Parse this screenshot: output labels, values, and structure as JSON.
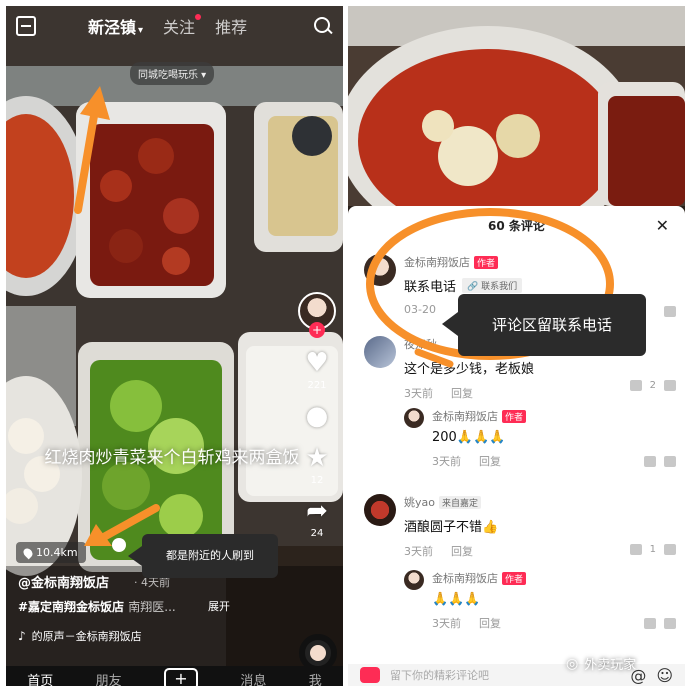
{
  "left": {
    "top_tabs": [
      {
        "label": "新泾镇",
        "caret": "▾"
      },
      {
        "label": "关注"
      },
      {
        "label": "推荐"
      }
    ],
    "city_chip": "同城吃喝玩乐 ▾",
    "side_actions": {
      "follow": "+",
      "likes": "221",
      "comments": "",
      "favorites": "12",
      "shares": "24"
    },
    "caption": "红烧肉炒青菜来个白斩鸡来两盒饭",
    "distance": "10.4km",
    "author": "@金标南翔饭店",
    "time": "· 4天前",
    "tags": "#嘉定南翔金标饭店",
    "tags_more": "南翔医...",
    "expand": "展开",
    "music": "的原声－金标南翔饭店",
    "bottom_nav": [
      "首页",
      "朋友",
      "+",
      "消息",
      "我"
    ],
    "annotation": "都是附近的人刷到"
  },
  "right": {
    "sheet_title": "60 条评论",
    "close": "✕",
    "annotation": "评论区留联系电话",
    "comments": [
      {
        "name": "金标南翔饭店",
        "badge": "作者",
        "text": "联系电话",
        "chip": "🔗 联系我们",
        "time": "03-20",
        "reply": "",
        "likes": ""
      },
      {
        "name": "夜知秋",
        "badge": "",
        "text": "这个是多少钱，老板娘",
        "time": "3天前",
        "reply": "回复",
        "likes": "2"
      },
      {
        "name": "金标南翔饭店",
        "badge": "作者",
        "text": "200🙏🙏🙏",
        "time": "3天前",
        "reply": "回复",
        "likes": ""
      },
      {
        "name": "姚yao",
        "badge": "来自嘉定",
        "text": "酒酿圆子不错👍",
        "time": "3天前",
        "reply": "回复",
        "likes": "1"
      },
      {
        "name": "金标南翔饭店",
        "badge": "作者",
        "text": "🙏🙏🙏",
        "time": "3天前",
        "reply": "回复",
        "likes": ""
      }
    ],
    "input_placeholder": "留下你的精彩评论吧",
    "at": "@",
    "emoji": "☺"
  },
  "watermark": "外卖玩家",
  "colors": {
    "accent": "#fe2c55",
    "annotation": "#f7902a"
  }
}
